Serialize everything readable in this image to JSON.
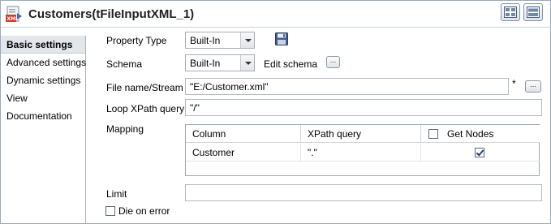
{
  "header": {
    "title": "Customers(tFileInputXML_1)",
    "icon": "component-xml-file-icon",
    "buttons": [
      "tabular-view-icon",
      "form-view-icon"
    ]
  },
  "sidebar": {
    "items": [
      {
        "label": "Basic settings",
        "active": true
      },
      {
        "label": "Advanced settings",
        "active": false
      },
      {
        "label": "Dynamic settings",
        "active": false
      },
      {
        "label": "View",
        "active": false
      },
      {
        "label": "Documentation",
        "active": false
      }
    ]
  },
  "form": {
    "property_type": {
      "label": "Property Type",
      "value": "Built-In"
    },
    "schema": {
      "label": "Schema",
      "value": "Built-In",
      "edit_label": "Edit schema",
      "browse_label": "..."
    },
    "file_name": {
      "label": "File name/Stream",
      "value": "\"E:/Customer.xml\"",
      "required_marker": "*",
      "browse_label": "..."
    },
    "loop_xpath": {
      "label": "Loop XPath query",
      "value": "\"/\""
    },
    "mapping": {
      "label": "Mapping",
      "columns": [
        "Column",
        "XPath query",
        "Get Nodes"
      ],
      "rows": [
        {
          "column": "Customer",
          "xpath": "\".\"",
          "get_nodes": true
        }
      ]
    },
    "limit": {
      "label": "Limit",
      "value": ""
    },
    "die_on_error": {
      "label": "Die on error",
      "checked": false
    }
  }
}
